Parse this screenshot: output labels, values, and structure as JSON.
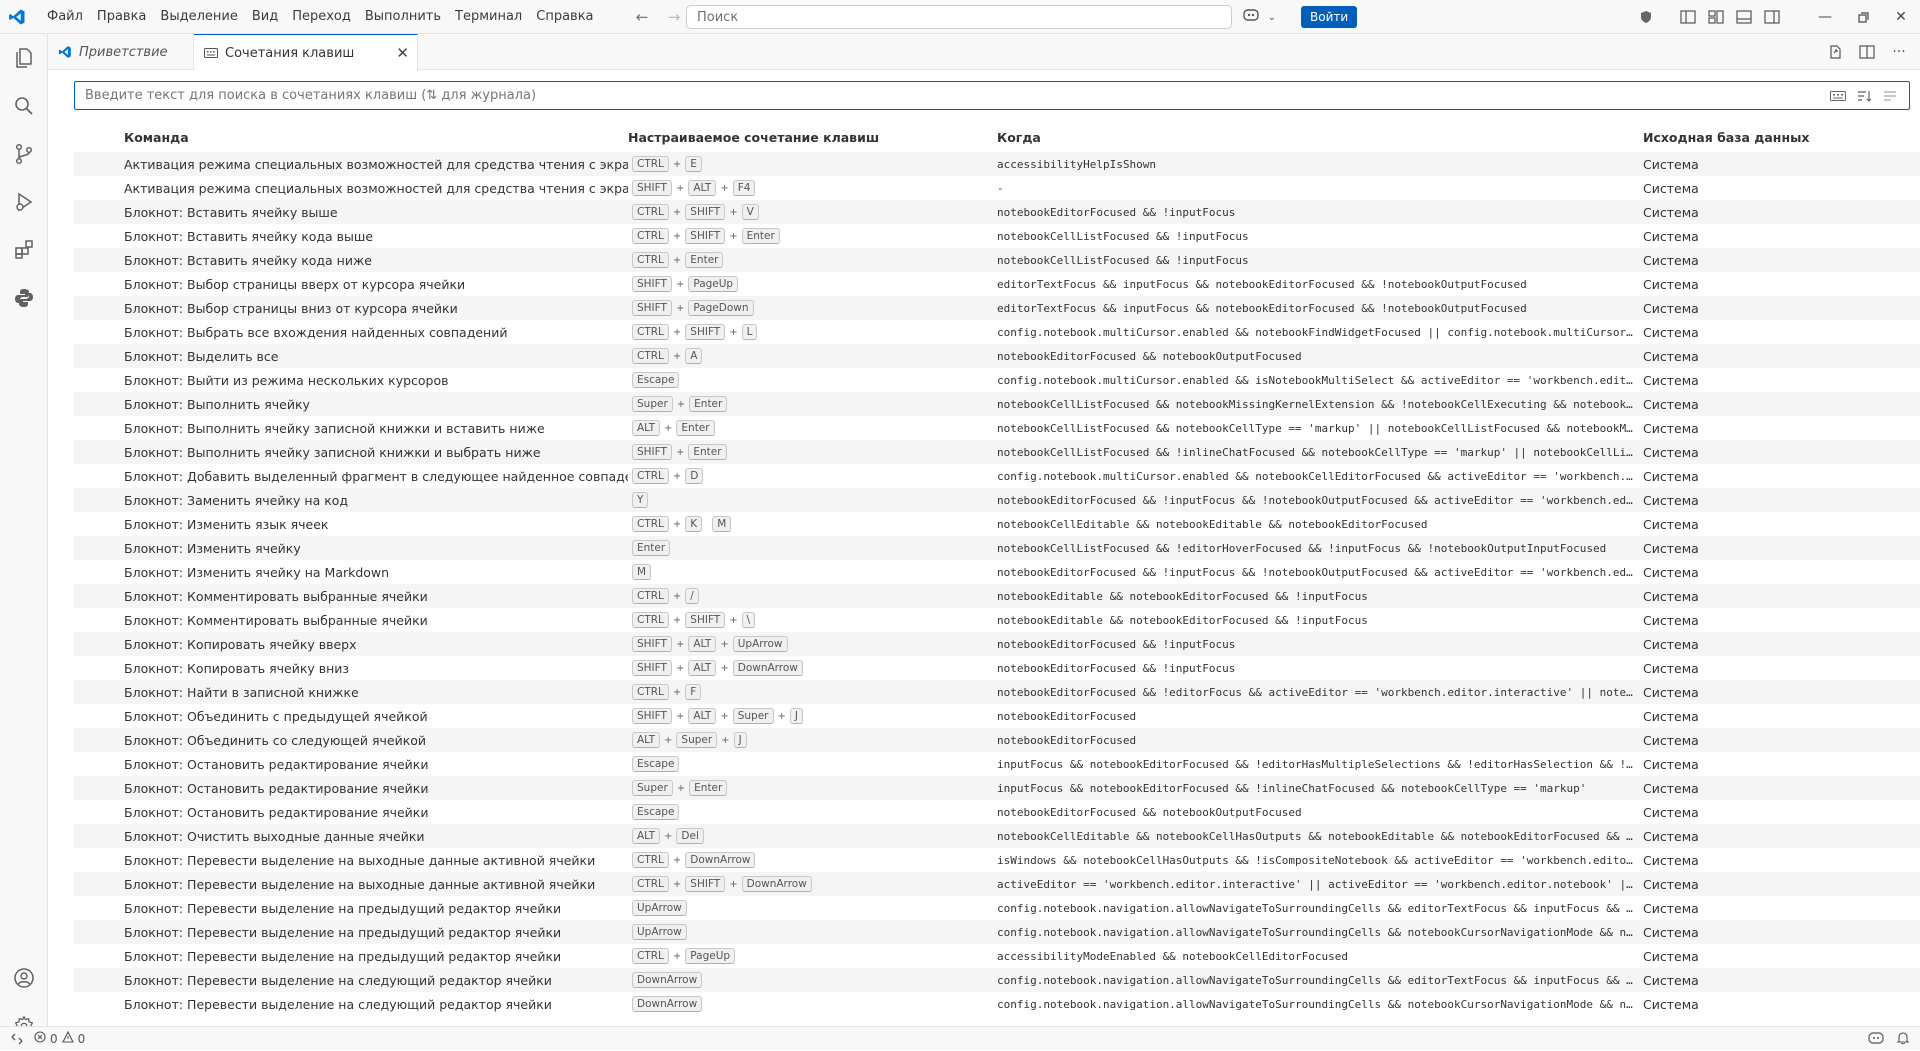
{
  "menu": [
    "Файл",
    "Правка",
    "Выделение",
    "Вид",
    "Переход",
    "Выполнить",
    "Терминал",
    "Справка"
  ],
  "search": {
    "placeholder": "Поиск"
  },
  "signin": "Войти",
  "tabs": [
    {
      "label": "Приветствие"
    },
    {
      "label": "Сочетания клавиш"
    }
  ],
  "kb_search": {
    "placeholder": "Введите текст для поиска в сочетаниях клавиш (⇅ для журнала)"
  },
  "columns": {
    "command": "Команда",
    "keybinding": "Настраиваемое сочетание клавиш",
    "when": "Когда",
    "source": "Исходная база данных"
  },
  "rows": [
    {
      "cmd": "Активация режима специальных возможностей для средства чтения с экрана",
      "keys": [
        "CTRL",
        "+",
        "E"
      ],
      "when": "accessibilityHelpIsShown",
      "src": "Система"
    },
    {
      "cmd": "Активация режима специальных возможностей для средства чтения с экрана",
      "keys": [
        "SHIFT",
        "+",
        "ALT",
        "+",
        "F4"
      ],
      "when": "-",
      "src": "Система"
    },
    {
      "cmd": "Блокнот: Вставить ячейку выше",
      "keys": [
        "CTRL",
        "+",
        "SHIFT",
        "+",
        "V"
      ],
      "when": "notebookEditorFocused && !inputFocus",
      "src": "Система"
    },
    {
      "cmd": "Блокнот: Вставить ячейку кода выше",
      "keys": [
        "CTRL",
        "+",
        "SHIFT",
        "+",
        "Enter"
      ],
      "when": "notebookCellListFocused && !inputFocus",
      "src": "Система"
    },
    {
      "cmd": "Блокнот: Вставить ячейку кода ниже",
      "keys": [
        "CTRL",
        "+",
        "Enter"
      ],
      "when": "notebookCellListFocused && !inputFocus",
      "src": "Система"
    },
    {
      "cmd": "Блокнот: Выбор страницы вверх от курсора ячейки",
      "keys": [
        "SHIFT",
        "+",
        "PageUp"
      ],
      "when": "editorTextFocus && inputFocus && notebookEditorFocused && !notebookOutputFocused",
      "src": "Система"
    },
    {
      "cmd": "Блокнот: Выбор страницы вниз от курсора ячейки",
      "keys": [
        "SHIFT",
        "+",
        "PageDown"
      ],
      "when": "editorTextFocus && inputFocus && notebookEditorFocused && !notebookOutputFocused",
      "src": "Система"
    },
    {
      "cmd": "Блокнот: Выбрать все вхождения найденных совпадений",
      "keys": [
        "CTRL",
        "+",
        "SHIFT",
        "+",
        "L"
      ],
      "when": "config.notebook.multiCursor.enabled && notebookFindWidgetFocused || config.notebook.multiCursor.enabled && notebookCellEditorFocused",
      "src": "Система"
    },
    {
      "cmd": "Блокнот: Выделить все",
      "keys": [
        "CTRL",
        "+",
        "A"
      ],
      "when": "notebookEditorFocused && notebookOutputFocused",
      "src": "Система"
    },
    {
      "cmd": "Блокнот: Выйти из режима нескольких курсоров",
      "keys": [
        "Escape"
      ],
      "when": "config.notebook.multiCursor.enabled && isNotebookMultiSelect && activeEditor == 'workbench.editor.notebook'",
      "src": "Система"
    },
    {
      "cmd": "Блокнот: Выполнить ячейку",
      "keys": [
        "Super",
        "+",
        "Enter"
      ],
      "when": "notebookCellListFocused && notebookMissingKernelExtension && !notebookCellExecuting && notebookCellType == 'code'",
      "src": "Система"
    },
    {
      "cmd": "Блокнот: Выполнить ячейку записной книжки и вставить ниже",
      "keys": [
        "ALT",
        "+",
        "Enter"
      ],
      "when": "notebookCellListFocused && notebookCellType == 'markup' || notebookCellListFocused && notebookMissingKernelExtension",
      "src": "Система"
    },
    {
      "cmd": "Блокнот: Выполнить ячейку записной книжки и выбрать ниже",
      "keys": [
        "SHIFT",
        "+",
        "Enter"
      ],
      "when": "notebookCellListFocused && !inlineChatFocused && notebookCellType == 'markup' || notebookCellListFocused && notebookMissingKernelExtension",
      "src": "Система"
    },
    {
      "cmd": "Блокнот: Добавить выделенный фрагмент в следующее найденное совпадение",
      "keys": [
        "CTRL",
        "+",
        "D"
      ],
      "when": "config.notebook.multiCursor.enabled && notebookCellEditorFocused && activeEditor == 'workbench.editor.notebook'",
      "src": "Система"
    },
    {
      "cmd": "Блокнот: Заменить ячейку на код",
      "keys": [
        "Y"
      ],
      "when": "notebookEditorFocused && !inputFocus && !notebookOutputFocused && activeEditor == 'workbench.editor.notebook'",
      "src": "Система"
    },
    {
      "cmd": "Блокнот: Изменить язык ячеек",
      "keys": [
        "CTRL",
        "+",
        "K",
        "_",
        "M"
      ],
      "when": "notebookCellEditable && notebookEditable && notebookEditorFocused",
      "src": "Система"
    },
    {
      "cmd": "Блокнот: Изменить ячейку",
      "keys": [
        "Enter"
      ],
      "when": "notebookCellListFocused && !editorHoverFocused && !inputFocus && !notebookOutputInputFocused",
      "src": "Система"
    },
    {
      "cmd": "Блокнот: Изменить ячейку на Markdown",
      "keys": [
        "M"
      ],
      "when": "notebookEditorFocused && !inputFocus && !notebookOutputFocused && activeEditor == 'workbench.editor.notebook'",
      "src": "Система"
    },
    {
      "cmd": "Блокнот: Комментировать выбранные ячейки",
      "keys": [
        "CTRL",
        "+",
        "/"
      ],
      "when": "notebookEditable && notebookEditorFocused && !inputFocus",
      "src": "Система"
    },
    {
      "cmd": "Блокнот: Комментировать выбранные ячейки",
      "keys": [
        "CTRL",
        "+",
        "SHIFT",
        "+",
        "\\"
      ],
      "when": "notebookEditable && notebookEditorFocused && !inputFocus",
      "src": "Система"
    },
    {
      "cmd": "Блокнот: Копировать ячейку вверх",
      "keys": [
        "SHIFT",
        "+",
        "ALT",
        "+",
        "UpArrow"
      ],
      "when": "notebookEditorFocused && !inputFocus",
      "src": "Система"
    },
    {
      "cmd": "Блокнот: Копировать ячейку вниз",
      "keys": [
        "SHIFT",
        "+",
        "ALT",
        "+",
        "DownArrow"
      ],
      "when": "notebookEditorFocused && !inputFocus",
      "src": "Система"
    },
    {
      "cmd": "Блокнот: Найти в записной книжке",
      "keys": [
        "CTRL",
        "+",
        "F"
      ],
      "when": "notebookEditorFocused && !editorFocus && activeEditor == 'workbench.editor.interactive' || notebookEditorFocused && activeEditor == 'workbench.editor.notebook'",
      "src": "Система"
    },
    {
      "cmd": "Блокнот: Объединить с предыдущей ячейкой",
      "keys": [
        "SHIFT",
        "+",
        "ALT",
        "+",
        "Super",
        "+",
        "J"
      ],
      "when": "notebookEditorFocused",
      "src": "Система"
    },
    {
      "cmd": "Блокнот: Объединить со следующей ячейкой",
      "keys": [
        "ALT",
        "+",
        "Super",
        "+",
        "J"
      ],
      "when": "notebookEditorFocused",
      "src": "Система"
    },
    {
      "cmd": "Блокнот: Остановить редактирование ячейки",
      "keys": [
        "Escape"
      ],
      "when": "inputFocus && notebookEditorFocused && !editorHasMultipleSelections && !editorHasSelection && !editorHoverVisible",
      "src": "Система"
    },
    {
      "cmd": "Блокнот: Остановить редактирование ячейки",
      "keys": [
        "Super",
        "+",
        "Enter"
      ],
      "when": "inputFocus && notebookEditorFocused && !inlineChatFocused && notebookCellType == 'markup'",
      "src": "Система"
    },
    {
      "cmd": "Блокнот: Остановить редактирование ячейки",
      "keys": [
        "Escape"
      ],
      "when": "notebookEditorFocused && notebookOutputFocused",
      "src": "Система"
    },
    {
      "cmd": "Блокнот: Очистить выходные данные ячейки",
      "keys": [
        "ALT",
        "+",
        "Del"
      ],
      "when": "notebookCellEditable && notebookCellHasOutputs && notebookEditable && notebookEditorFocused && !inputFocus",
      "src": "Система"
    },
    {
      "cmd": "Блокнот: Перевести выделение на выходные данные активной ячейки",
      "keys": [
        "CTRL",
        "+",
        "DownArrow"
      ],
      "when": "isWindows && notebookCellHasOutputs && !isCompositeNotebook && activeEditor == 'workbench.editor.notebook' || isLinux",
      "src": "Система"
    },
    {
      "cmd": "Блокнот: Перевести выделение на выходные данные активной ячейки",
      "keys": [
        "CTRL",
        "+",
        "SHIFT",
        "+",
        "DownArrow"
      ],
      "when": "activeEditor == 'workbench.editor.interactive' || activeEditor == 'workbench.editor.notebook' || isLinux",
      "src": "Система"
    },
    {
      "cmd": "Блокнот: Перевести выделение на предыдущий редактор ячейки",
      "keys": [
        "UpArrow"
      ],
      "when": "config.notebook.navigation.allowNavigateToSurroundingCells && editorTextFocus && inputFocus && notebookEditorFocused",
      "src": "Система"
    },
    {
      "cmd": "Блокнот: Перевести выделение на предыдущий редактор ячейки",
      "keys": [
        "UpArrow"
      ],
      "when": "config.notebook.navigation.allowNavigateToSurroundingCells && notebookCursorNavigationMode && notebookEditorFocused",
      "src": "Система"
    },
    {
      "cmd": "Блокнот: Перевести выделение на предыдущий редактор ячейки",
      "keys": [
        "CTRL",
        "+",
        "PageUp"
      ],
      "when": "accessibilityModeEnabled && notebookCellEditorFocused",
      "src": "Система"
    },
    {
      "cmd": "Блокнот: Перевести выделение на следующий редактор ячейки",
      "keys": [
        "DownArrow"
      ],
      "when": "config.notebook.navigation.allowNavigateToSurroundingCells && editorTextFocus && inputFocus && notebookEditorFocused",
      "src": "Система"
    },
    {
      "cmd": "Блокнот: Перевести выделение на следующий редактор ячейки",
      "keys": [
        "DownArrow"
      ],
      "when": "config.notebook.navigation.allowNavigateToSurroundingCells && notebookCursorNavigationMode && notebookEditorFocused",
      "src": "Система"
    }
  ],
  "status": {
    "errors": "0",
    "warnings": "0"
  }
}
